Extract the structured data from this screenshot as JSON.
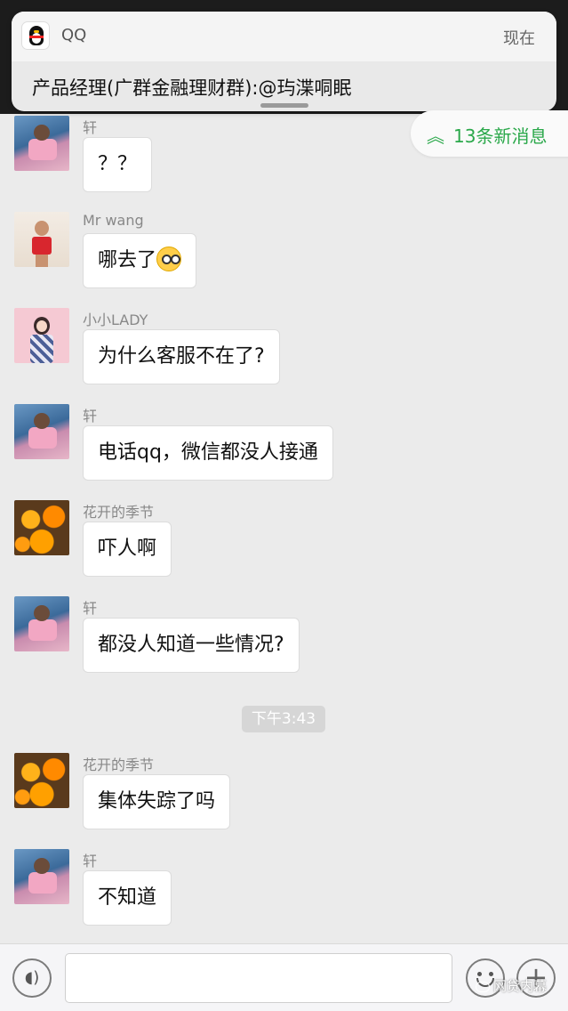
{
  "notification": {
    "app_name": "QQ",
    "time": "现在",
    "message": "产品经理(广群金融理财群):@玙渫哃眠",
    "icon": "qq-penguin-icon"
  },
  "new_messages": {
    "label": "13条新消息",
    "icon": "double-chevron-up-icon",
    "accent": "#2aa84a"
  },
  "messages": [
    {
      "sender": "轩",
      "text": "？？"
    },
    {
      "sender": "Mr wang",
      "text": "哪去了",
      "emoji": "shocked-face-emoji"
    },
    {
      "sender": "小小LADY",
      "text": "为什么客服不在了?"
    },
    {
      "sender": "轩",
      "text": "电话qq，微信都没人接通"
    },
    {
      "sender": "花开的季节",
      "text": "吓人啊"
    },
    {
      "sender": "轩",
      "text": "都没人知道一些情况?"
    },
    {
      "sender": "花开的季节",
      "text": "集体失踪了吗"
    },
    {
      "sender": "轩",
      "text": "不知道"
    }
  ],
  "timestamp": "下午3:43",
  "input_bar": {
    "voice_icon": "voice-icon",
    "emoji_icon": "emoji-icon",
    "plus_icon": "plus-icon"
  },
  "watermark": "网贷内幕"
}
